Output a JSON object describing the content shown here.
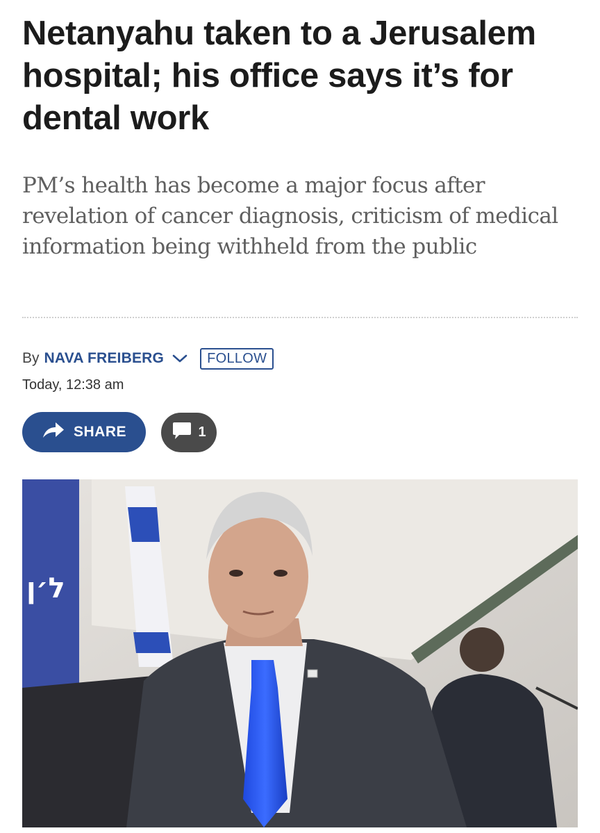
{
  "article": {
    "headline": "Netanyahu taken to a Jerusalem hospital; his office says it’s for dental work",
    "subheadline": "PM’s health has become a major focus after revelation of cancer diagnosis, criticism of medical information being withheld from the public"
  },
  "byline": {
    "prefix": "By",
    "author": "NAVA FREIBERG",
    "follow_label": "FOLLOW",
    "timestamp": "Today, 12:38 am"
  },
  "actions": {
    "share_label": "SHARE",
    "comment_count": "1"
  },
  "icons": {
    "author_menu": "chevron-down-icon",
    "share": "share-arrow-icon",
    "comments": "comment-bubble-icon"
  },
  "colors": {
    "accent": "#2a4f8f",
    "comments_button": "#4a4a4a",
    "subhead_text": "#5f5f5f"
  }
}
